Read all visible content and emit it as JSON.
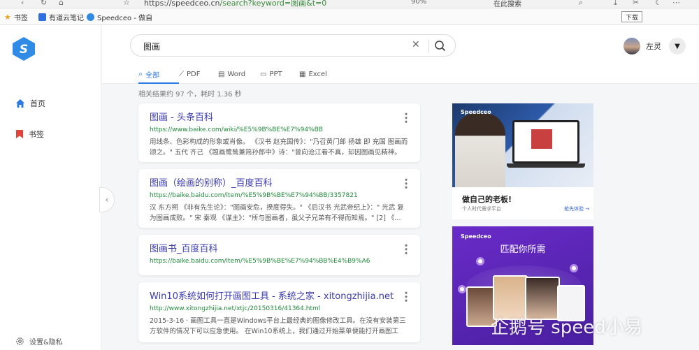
{
  "browser": {
    "url_host": "https://speedceo.cn",
    "url_path": "/search?keyword=图画&t=0",
    "zoom": "90%",
    "search_here": "在此搜索",
    "tooltip": "下载"
  },
  "bookmarks_bar": {
    "items": [
      {
        "label": "书签",
        "icon": "star-icon"
      },
      {
        "label": "有道云笔记",
        "icon": "youdao-icon"
      },
      {
        "label": "Speedceo - 做自",
        "icon": "speedceo-icon"
      }
    ]
  },
  "sidebar": {
    "logo": "S",
    "items": [
      {
        "label": "首页",
        "icon": "home-icon"
      },
      {
        "label": "书签",
        "icon": "bookmark-icon"
      }
    ],
    "settings_label": "设置&隐私"
  },
  "search": {
    "query": "图画"
  },
  "tabs": [
    {
      "label": "全部",
      "icon": "search-icon",
      "active": true
    },
    {
      "label": "PDF",
      "icon": "pdf-icon",
      "active": false
    },
    {
      "label": "Word",
      "icon": "word-icon",
      "active": false
    },
    {
      "label": "PPT",
      "icon": "ppt-icon",
      "active": false
    },
    {
      "label": "Excel",
      "icon": "excel-icon",
      "active": false
    }
  ],
  "user": {
    "name": "左灵"
  },
  "result_count": "相关结果约 97 个，耗时 1.36 秒",
  "results": [
    {
      "title": "图画 - 头条百科",
      "url": "https://www.baike.com/wiki/%E5%9B%BE%E7%94%BB",
      "desc": "用线条、色彩构成的形象或肖像。 《汉书 赵充国传》：\"乃召黄门郎 扬雄 即 充国 图画而颂之。\" 五代 齐己 《题画鹭鸶兼简孙郎中》诗：\"曾向沧江看不真，却因图画见精神。 ..."
    },
    {
      "title": "图画（绘画的别称）_百度百科",
      "url": "https://baike.baidu.com/item/%E5%9B%BE%E7%94%BB/3357821",
      "desc": "汉 东方朔 《非有先生论》：\"图画安危，揆度得失。\" 《后汉书 光武帝纪上》：\" 光武 复为图画成败。\" 宋 秦观 《谋主》：\"所与图画者，虽父子兄弟有不得而知焉。\" [2] 《..."
    },
    {
      "title": "图画书_百度百科",
      "url": "https://baike.baidu.com/item/%E5%9B%BE%E7%94%BB%E4%B9%A6",
      "desc": ""
    },
    {
      "title": "Win10系统如何打开画图工具 - 系统之家 - xitongzhijia.net",
      "url": "http://www.xitongzhijia.net/xtjc/20150316/41364.html",
      "desc": "2015-3-16 · 画图工具一直是Windows平台上最经典的图像修改工具。在没有安装第三方软件的情况下可以应急使用。 在Win10系统上，我们通过开始菜单便能打开画图工具..."
    }
  ],
  "ads": [
    {
      "brand": "Speedceo",
      "headline": "做自己的老板!",
      "sub": "个人时代需求平台",
      "cta": "抢先体验 →"
    },
    {
      "brand": "Speedceo",
      "headline": "匹配你所需"
    }
  ],
  "watermark": "企鹅号 speed小易",
  "colors": {
    "accent": "#2c7be5",
    "link_title": "#3b3bb0",
    "link_url": "#1f8a3a",
    "ad_purple": "#5524b0"
  }
}
